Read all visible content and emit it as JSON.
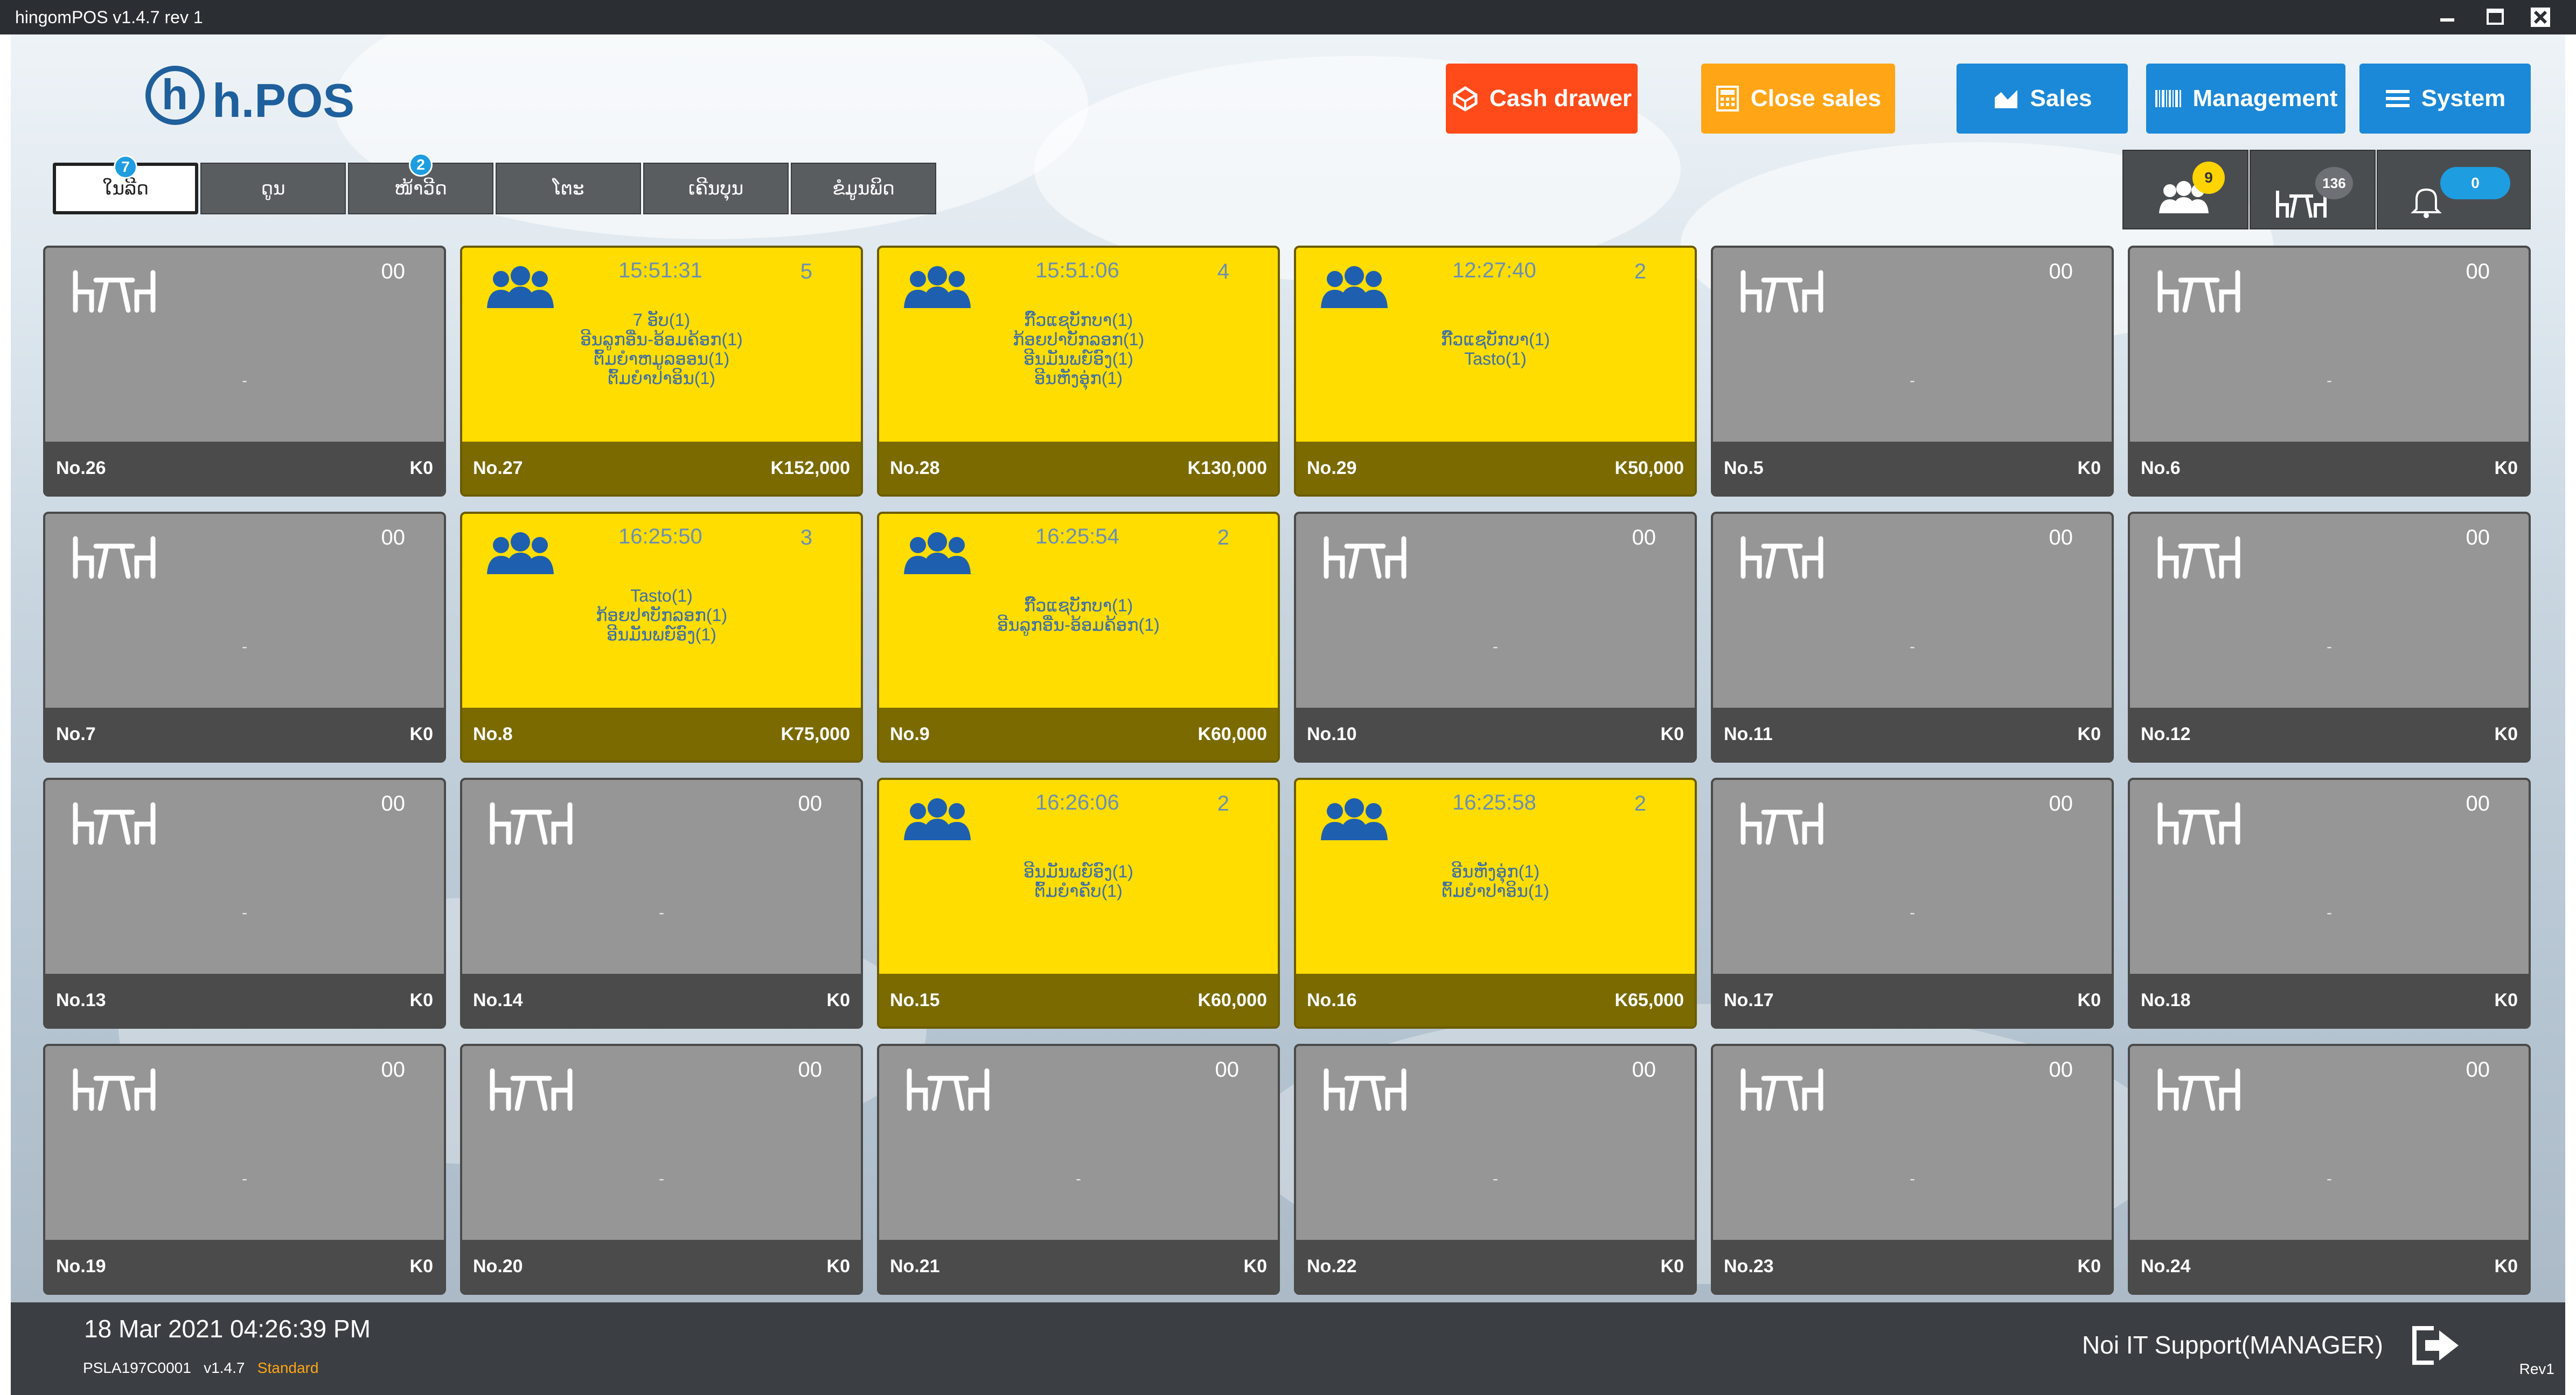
{
  "window": {
    "title": "hingomPOS v1.4.7 rev 1"
  },
  "logo": {
    "text": "h.POS"
  },
  "top_buttons": {
    "cash_drawer": "Cash drawer",
    "close_sales": "Close sales",
    "sales": "Sales",
    "management": "Management",
    "system": "System"
  },
  "tabs": [
    {
      "label": "ໃນລີດ",
      "badge": "7"
    },
    {
      "label": "ດູນ",
      "badge": ""
    },
    {
      "label": "ໜ້າວີດ",
      "badge": "2"
    },
    {
      "label": "ໂຕະ",
      "badge": ""
    },
    {
      "label": "ເຄີນບຸນ",
      "badge": ""
    },
    {
      "label": "ຂໍມູນພິດ",
      "badge": ""
    }
  ],
  "right_panel": {
    "guests_badge": "9",
    "tables_badge": "136",
    "notifications_badge": "0"
  },
  "tables": [
    {
      "no": "No.26",
      "amount": "K0",
      "count": "00",
      "occupied": false,
      "dash": "-"
    },
    {
      "no": "No.27",
      "amount": "K152,000",
      "count": "5",
      "occupied": true,
      "time": "15:51:31",
      "items": [
        "7 ອັບ(1)",
        "ອີນລູກອື່ນ-ອ້ອມຄ້ອກ(1)",
        "ຕົ້ມຍໍາຫມູລອອນ(1)",
        "ຕົ້ມຍໍາປາອິນ(1)"
      ]
    },
    {
      "no": "No.28",
      "amount": "K130,000",
      "count": "4",
      "occupied": true,
      "time": "15:51:06",
      "items": [
        "ກົ໊ວແຊບັກບາ(1)",
        "ກ້ອຍປາບັກລອກ(1)",
        "ອີນມັນພຍ໌ອົງ(1)",
        "ອີນຫັງອຸ່ກ(1)"
      ]
    },
    {
      "no": "No.29",
      "amount": "K50,000",
      "count": "2",
      "occupied": true,
      "time": "12:27:40",
      "items": [
        "ກົ໊ວແຊບັກບາ(1)",
        "Tasto(1)"
      ]
    },
    {
      "no": "No.5",
      "amount": "K0",
      "count": "00",
      "occupied": false,
      "dash": "-"
    },
    {
      "no": "No.6",
      "amount": "K0",
      "count": "00",
      "occupied": false,
      "dash": "-"
    },
    {
      "no": "No.7",
      "amount": "K0",
      "count": "00",
      "occupied": false,
      "dash": "-"
    },
    {
      "no": "No.8",
      "amount": "K75,000",
      "count": "3",
      "occupied": true,
      "time": "16:25:50",
      "items": [
        "Tasto(1)",
        "ກ້ອຍປາບັກລອກ(1)",
        "ອີນມັນພຍ໌ອົງ(1)"
      ]
    },
    {
      "no": "No.9",
      "amount": "K60,000",
      "count": "2",
      "occupied": true,
      "time": "16:25:54",
      "items": [
        "ກົ໊ວແຊບັກບາ(1)",
        "ອີນລູກອື່ນ-ອ້ອມຄ້ອກ(1)"
      ]
    },
    {
      "no": "No.10",
      "amount": "K0",
      "count": "00",
      "occupied": false,
      "dash": "-"
    },
    {
      "no": "No.11",
      "amount": "K0",
      "count": "00",
      "occupied": false,
      "dash": "-"
    },
    {
      "no": "No.12",
      "amount": "K0",
      "count": "00",
      "occupied": false,
      "dash": "-"
    },
    {
      "no": "No.13",
      "amount": "K0",
      "count": "00",
      "occupied": false,
      "dash": "-"
    },
    {
      "no": "No.14",
      "amount": "K0",
      "count": "00",
      "occupied": false,
      "dash": "-"
    },
    {
      "no": "No.15",
      "amount": "K60,000",
      "count": "2",
      "occupied": true,
      "time": "16:26:06",
      "items": [
        "ອີນມັນພຍ໌ອົງ(1)",
        "ຕົ້ມຍໍາຄັບ(1)"
      ]
    },
    {
      "no": "No.16",
      "amount": "K65,000",
      "count": "2",
      "occupied": true,
      "time": "16:25:58",
      "items": [
        "ອີນຫັງອຸ່ກ(1)",
        "ຕົ້ມຍໍາປາອິນ(1)"
      ]
    },
    {
      "no": "No.17",
      "amount": "K0",
      "count": "00",
      "occupied": false,
      "dash": "-"
    },
    {
      "no": "No.18",
      "amount": "K0",
      "count": "00",
      "occupied": false,
      "dash": "-"
    },
    {
      "no": "No.19",
      "amount": "K0",
      "count": "00",
      "occupied": false,
      "dash": "-"
    },
    {
      "no": "No.20",
      "amount": "K0",
      "count": "00",
      "occupied": false,
      "dash": "-"
    },
    {
      "no": "No.21",
      "amount": "K0",
      "count": "00",
      "occupied": false,
      "dash": "-"
    },
    {
      "no": "No.22",
      "amount": "K0",
      "count": "00",
      "occupied": false,
      "dash": "-"
    },
    {
      "no": "No.23",
      "amount": "K0",
      "count": "00",
      "occupied": false,
      "dash": "-"
    },
    {
      "no": "No.24",
      "amount": "K0",
      "count": "00",
      "occupied": false,
      "dash": "-"
    }
  ],
  "status_bar": {
    "datetime": "18 Mar 2021 04:26:39 PM",
    "device": "PSLA197C0001",
    "version": "v1.4.7",
    "edition": "Standard",
    "user": "Noi IT Support(MANAGER)",
    "rev": "Rev1"
  },
  "colors": {
    "cash_drawer": "#ff4a1a",
    "close_sales": "#ffa516",
    "blue": "#1b88d8",
    "occupied": "#ffdd00",
    "empty": "#969696"
  }
}
